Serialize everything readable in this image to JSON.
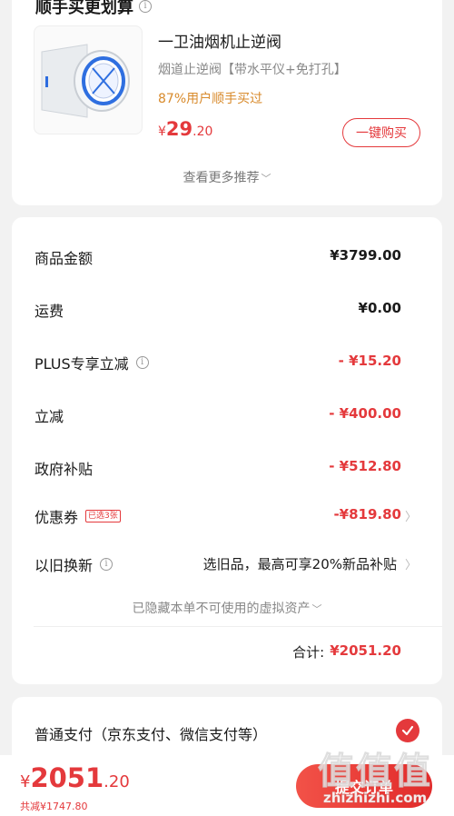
{
  "recommend": {
    "title": "顺手买更划算",
    "product": {
      "name": "一卫油烟机止逆阀",
      "desc": "烟道止逆阀【带水平仪+免打孔】",
      "buyers": "87%用户顺手买过",
      "price_currency": "¥",
      "price_int": "29",
      "price_dec": ".20",
      "buy_label": "一键购买"
    },
    "more_label": "查看更多推荐"
  },
  "summary": {
    "goods_amount": {
      "label": "商品金额",
      "value": "¥3799.00"
    },
    "shipping": {
      "label": "运费",
      "value": "¥0.00"
    },
    "plus_discount": {
      "label": "PLUS专享立减",
      "value": "- ¥15.20"
    },
    "instant_discount": {
      "label": "立减",
      "value": "- ¥400.00"
    },
    "gov_subsidy": {
      "label": "政府补贴",
      "value": "- ¥512.80"
    },
    "coupon": {
      "label": "优惠券",
      "badge": "已选3张",
      "value": "-¥819.80"
    },
    "trade_in": {
      "label": "以旧换新",
      "value": "选旧品，最高可享20%新品补贴"
    },
    "hidden_assets": "已隐藏本单不可使用的虚拟资产",
    "total_label": "合计:",
    "total_value": "¥2051.20"
  },
  "payment": {
    "option_label": "普通支付（京东支付、微信支付等）",
    "selected": true
  },
  "bottom": {
    "price_currency": "¥",
    "price_int": "2051",
    "price_dec": ".20",
    "saved": "共减¥1747.80",
    "submit_label": "提交订单"
  },
  "watermark": {
    "chars": "值值值",
    "url": "zhizhizhi.com"
  },
  "colors": {
    "accent": "#e4393c",
    "gold": "#d88a2b"
  }
}
